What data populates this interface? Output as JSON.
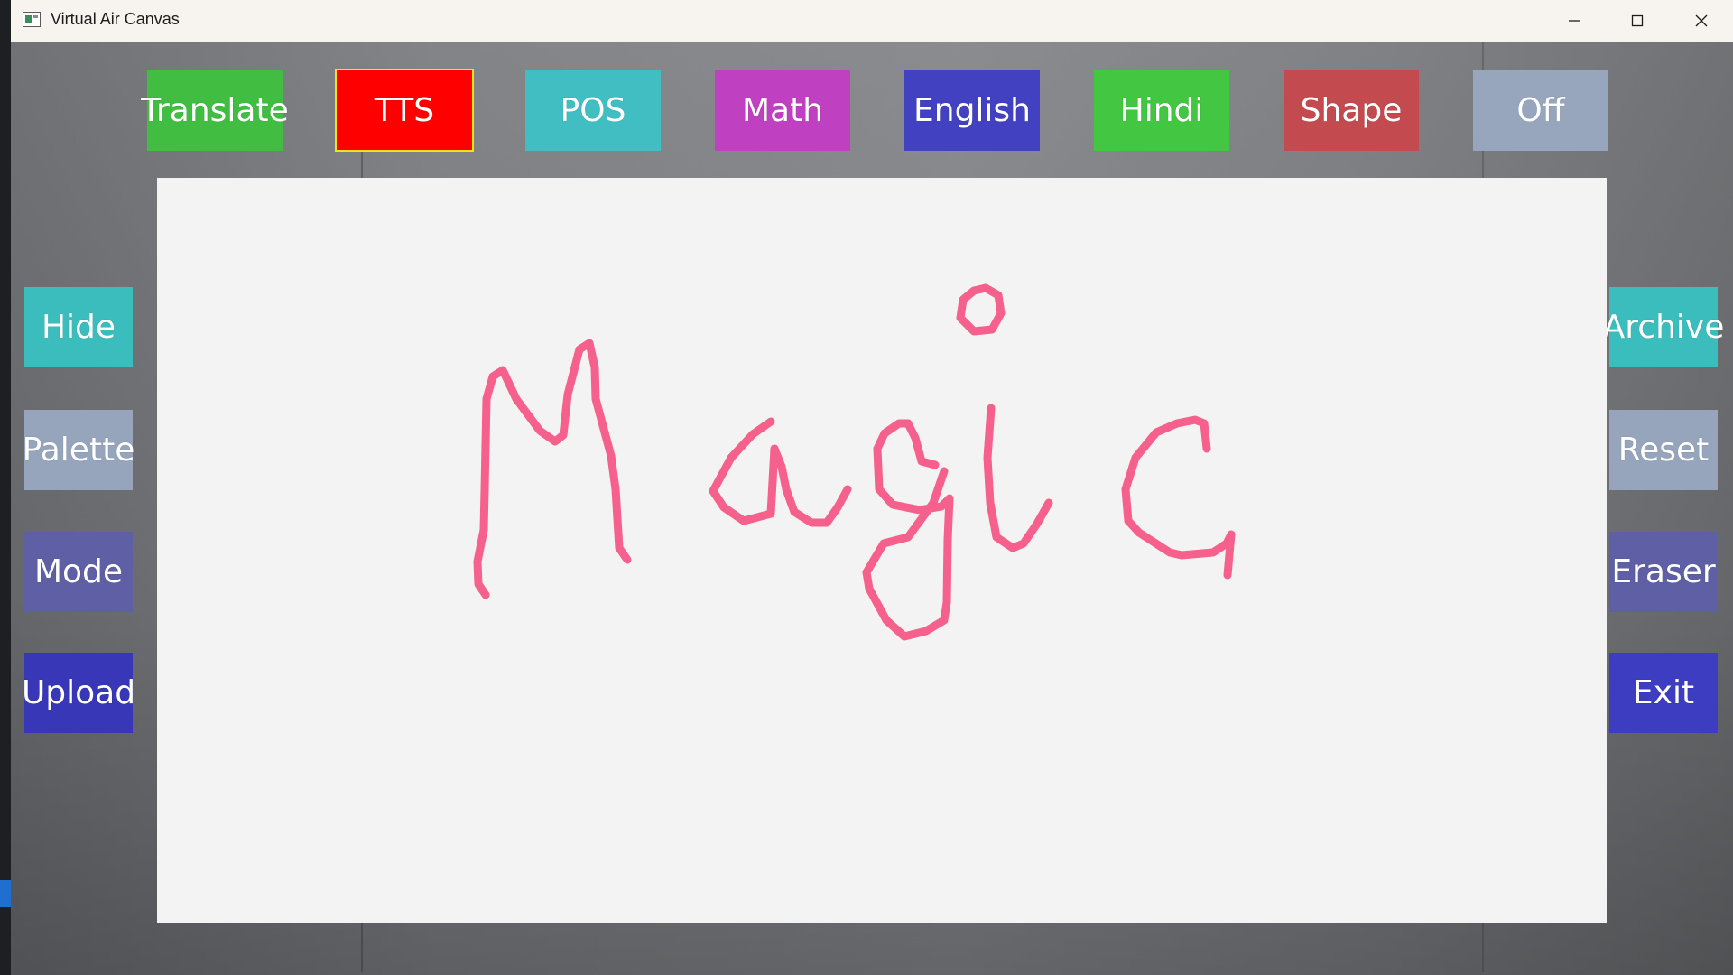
{
  "window": {
    "title": "Virtual Air Canvas",
    "controls": [
      "minimize",
      "maximize",
      "close"
    ]
  },
  "top_toolbar": [
    {
      "label": "Translate",
      "color": "#41be41",
      "selected": false
    },
    {
      "label": "TTS",
      "color": "#ff0000",
      "selected": true,
      "border": "#f5e21a"
    },
    {
      "label": "POS",
      "color": "#41bec2",
      "selected": false
    },
    {
      "label": "Math",
      "color": "#bf41c2",
      "selected": false
    },
    {
      "label": "English",
      "color": "#4141c2",
      "selected": false
    },
    {
      "label": "Hindi",
      "color": "#43c743",
      "selected": false
    },
    {
      "label": "Shape",
      "color": "#c34a4e",
      "selected": false
    },
    {
      "label": "Off",
      "color": "#97a6bd",
      "selected": false
    }
  ],
  "left_toolbar": [
    {
      "label": "Hide",
      "color": "#3cbdbd"
    },
    {
      "label": "Palette",
      "color": "#96a5bb"
    },
    {
      "label": "Mode",
      "color": "#5f5fa5"
    },
    {
      "label": "Upload",
      "color": "#3737b8"
    }
  ],
  "right_toolbar": [
    {
      "label": "Archive",
      "color": "#3cbdbd"
    },
    {
      "label": "Reset",
      "color": "#96a5bb"
    },
    {
      "label": "Eraser",
      "color": "#5f5fa5"
    },
    {
      "label": "Exit",
      "color": "#3d3dc2"
    }
  ],
  "canvas": {
    "background": "#f3f3f3",
    "stroke_color": "#f5618c",
    "drawing": "Magic"
  }
}
